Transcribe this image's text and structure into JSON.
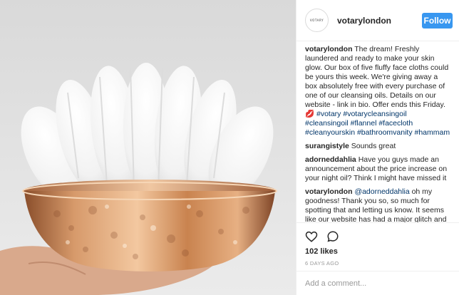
{
  "post": {
    "username": "votarylondon",
    "avatar_text": "VOTARY",
    "follow_label": "Follow",
    "likes": "102 likes",
    "time_ago": "6 DAYS AGO",
    "comment_placeholder": "Add a comment..."
  },
  "comments": [
    {
      "user": "votarylondon",
      "text": "The dream! Freshly laundered and ready to make your skin glow. Our box of five fluffy face cloths could be yours this week. We're giving away a box absolutely free with every purchase of one of our cleansing oils. Details on our website - link in bio. Offer ends this Friday. ",
      "emoji": "💋",
      "hashtags": "#votary #votarycleansingoil #cleansingoil #flannel #facecloth #cleanyourskin #bathroomvanity #hammam"
    },
    {
      "user": "surangistyle",
      "text": "Sounds great"
    },
    {
      "user": "adorneddahlia",
      "text": "Have you guys made an announcement about the price increase on your night oil? Think I might have missed it"
    },
    {
      "user": "votarylondon",
      "mention": "@adorneddahlia",
      "text": " oh my goodness! Thank you so, so much for spotting that and letting us know. It seems like our website has had a major glitch and made the Night Oil price the same as a"
    }
  ],
  "icons": [
    "heart-icon",
    "comment-icon"
  ],
  "colors": {
    "follow": "#3897f0",
    "link": "#003569",
    "muted": "#999999",
    "copper": "#c98a5a"
  }
}
